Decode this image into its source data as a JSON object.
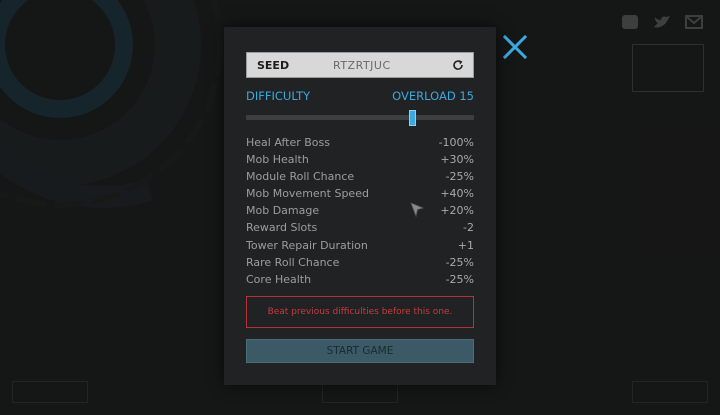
{
  "seed": {
    "label": "SEED",
    "value": "RTZRTJUC",
    "refresh_icon": "refresh-icon"
  },
  "difficulty": {
    "label": "DIFFICULTY",
    "value": "OVERLOAD 15",
    "level_fraction": 0.73
  },
  "modifiers": [
    {
      "name": "Heal After Boss",
      "value": "-100%"
    },
    {
      "name": "Mob Health",
      "value": "+30%"
    },
    {
      "name": "Module Roll Chance",
      "value": "-25%"
    },
    {
      "name": "Mob Movement Speed",
      "value": "+40%"
    },
    {
      "name": "Mob Damage",
      "value": "+20%"
    },
    {
      "name": "Reward Slots",
      "value": "-2"
    },
    {
      "name": "Tower Repair Duration",
      "value": "+1"
    },
    {
      "name": "Rare Roll Chance",
      "value": "-25%"
    },
    {
      "name": "Core Health",
      "value": "-25%"
    }
  ],
  "warning": "Beat previous difficulties before this one.",
  "start_button": "START GAME",
  "colors": {
    "accent": "#3aa9e0",
    "warning": "#c9393e",
    "start_bg": "#3b5a66",
    "panel": "#212223"
  },
  "icons": {
    "close": "close-icon",
    "cursor": "mouse-cursor-icon"
  }
}
